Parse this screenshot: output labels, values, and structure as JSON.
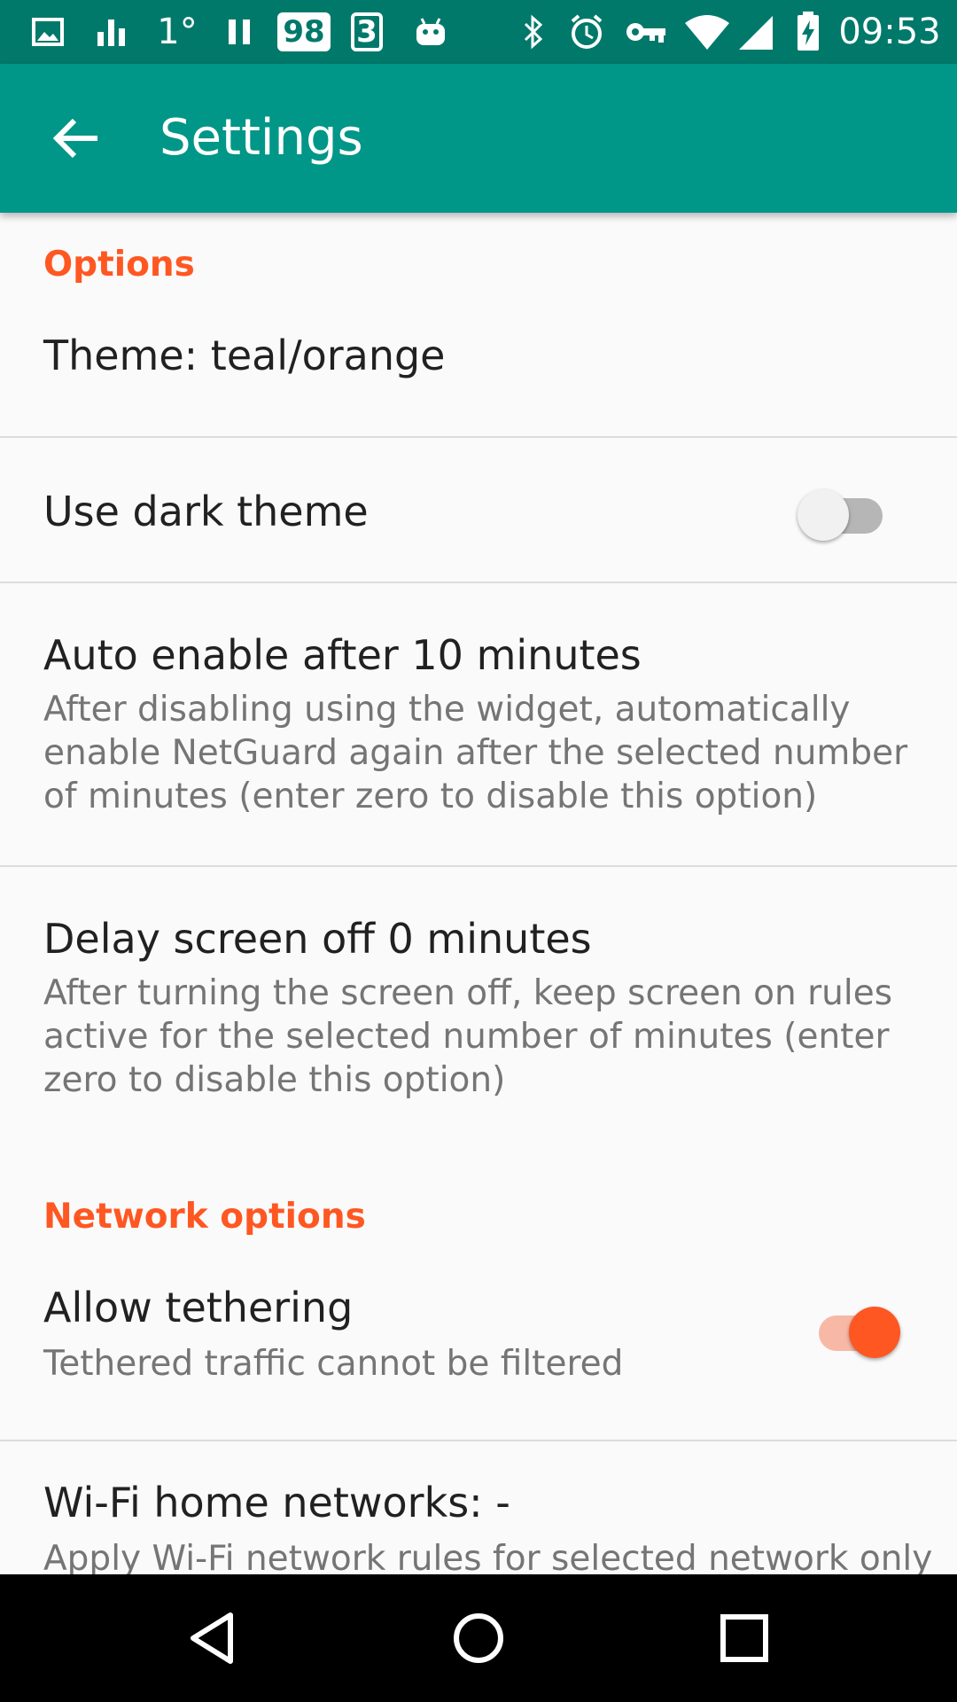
{
  "statusbar": {
    "temperature": "1°",
    "badge_98": "98",
    "badge_3": "3",
    "time": "09:53"
  },
  "appbar": {
    "title": "Settings"
  },
  "sections": {
    "options": {
      "header": "Options",
      "theme_title": "Theme: teal/orange",
      "dark_theme_title": "Use dark theme",
      "dark_theme_enabled": false,
      "auto_enable_title": "Auto enable after 10 minutes",
      "auto_enable_summary": "After disabling using the widget, automatically enable NetGuard again after the selected number of minutes (enter zero to disable this option)",
      "delay_title": "Delay screen off 0 minutes",
      "delay_summary": "After turning the screen off, keep screen on rules active for the selected number of minutes (enter zero to disable this option)"
    },
    "network": {
      "header": "Network options",
      "tethering_title": "Allow tethering",
      "tethering_summary": "Tethered traffic cannot be filtered",
      "tethering_enabled": true,
      "wifi_title": "Wi-Fi home networks: -",
      "wifi_summary": "Apply Wi-Fi network rules for selected network only"
    }
  },
  "colors": {
    "primary": "#009688",
    "primary_dark": "#00796b",
    "accent": "#ff5722"
  }
}
